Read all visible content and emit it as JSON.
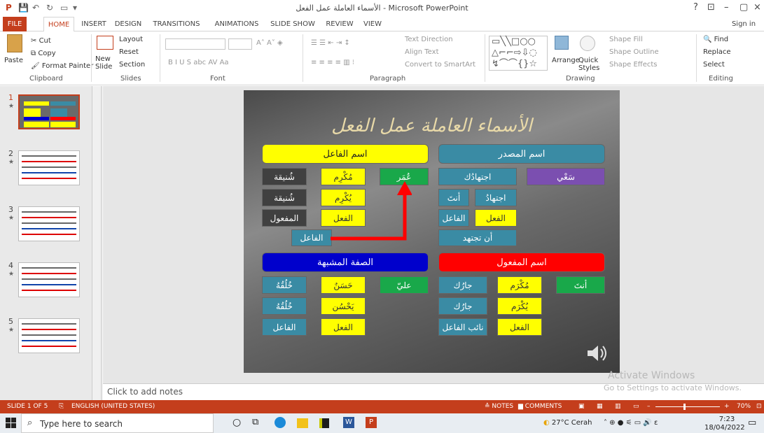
{
  "window": {
    "title": "الأسماء العاملة عمل الفعل - Microsoft PowerPoint",
    "help": "?",
    "sign_in": "Sign in"
  },
  "tabs": [
    "FILE",
    "HOME",
    "INSERT",
    "DESIGN",
    "TRANSITIONS",
    "ANIMATIONS",
    "SLIDE SHOW",
    "REVIEW",
    "VIEW"
  ],
  "ribbon": {
    "clipboard": {
      "paste": "Paste",
      "cut": "Cut",
      "copy": "Copy",
      "format_painter": "Format Painter",
      "label": "Clipboard"
    },
    "slides": {
      "new_slide": "New Slide",
      "layout": "Layout",
      "reset": "Reset",
      "section": "Section",
      "label": "Slides"
    },
    "font": {
      "label": "Font",
      "buttons": "B  I  U  S  abc  AV  Aa"
    },
    "paragraph": {
      "text_direction": "Text Direction",
      "align_text": "Align Text",
      "convert": "Convert to SmartArt",
      "label": "Paragraph"
    },
    "drawing": {
      "arrange": "Arrange",
      "quick_styles": "Quick Styles",
      "shape_fill": "Shape Fill",
      "shape_outline": "Shape Outline",
      "shape_effects": "Shape Effects",
      "label": "Drawing"
    },
    "editing": {
      "find": "Find",
      "replace": "Replace",
      "select": "Select",
      "label": "Editing"
    }
  },
  "thumbs": [
    {
      "num": "1",
      "star": "★"
    },
    {
      "num": "2",
      "star": "★"
    },
    {
      "num": "3",
      "star": "★"
    },
    {
      "num": "4",
      "star": "★"
    },
    {
      "num": "5",
      "star": "★"
    }
  ],
  "slide": {
    "title": "الأسماء العاملة عمل الفعل",
    "headers": {
      "fa3el": "اسم الفاعل",
      "masdar": "اسم المصدر",
      "sifa": "الصفة المشبهة",
      "maf3ool": "اسم المفعول"
    },
    "cells": {
      "a1": "مُكْرِم",
      "a2": "يُكْرِم",
      "a3": "الفعل",
      "a4": "عُمَر",
      "d1": "شُنيقة",
      "d2": "شُنيقة",
      "d3": "المفعول",
      "lab": "الفاعل",
      "m1": "اجتهادُك",
      "m2": "سَعْي",
      "m3": "اجتهادُ",
      "m4": "أنتَ",
      "m5": "الفاعل",
      "m6": "الفعل",
      "m7": "أن تجتهد",
      "s1": "حَسَنٌ",
      "s2": "يَحْسُن",
      "s3": "الفعل",
      "s4": "عليّ",
      "s5": "خُلُقُهُ",
      "s6": "خُلُقُهُ",
      "s7": "الفاعل",
      "o1": "مُكْرَم",
      "o2": "يُكْرَم",
      "o3": "الفعل",
      "o4": "أنتَ",
      "o5": "جارُك",
      "o6": "جارُك",
      "o7": "نائب الفاعل"
    }
  },
  "notes": "Click to add notes",
  "watermark": {
    "line1": "Activate Windows",
    "line2": "Go to Settings to activate Windows."
  },
  "status": {
    "slide": "SLIDE 1 OF 5",
    "lang": "ENGLISH (UNITED STATES)",
    "notes": "NOTES",
    "comments": "COMMENTS",
    "zoom": "70%"
  },
  "taskbar": {
    "search": "Type here to search",
    "weather": "27°C Cerah",
    "time": "7:23",
    "date": "18/04/2022"
  },
  "colors": {
    "accent": "#c43e1c"
  }
}
